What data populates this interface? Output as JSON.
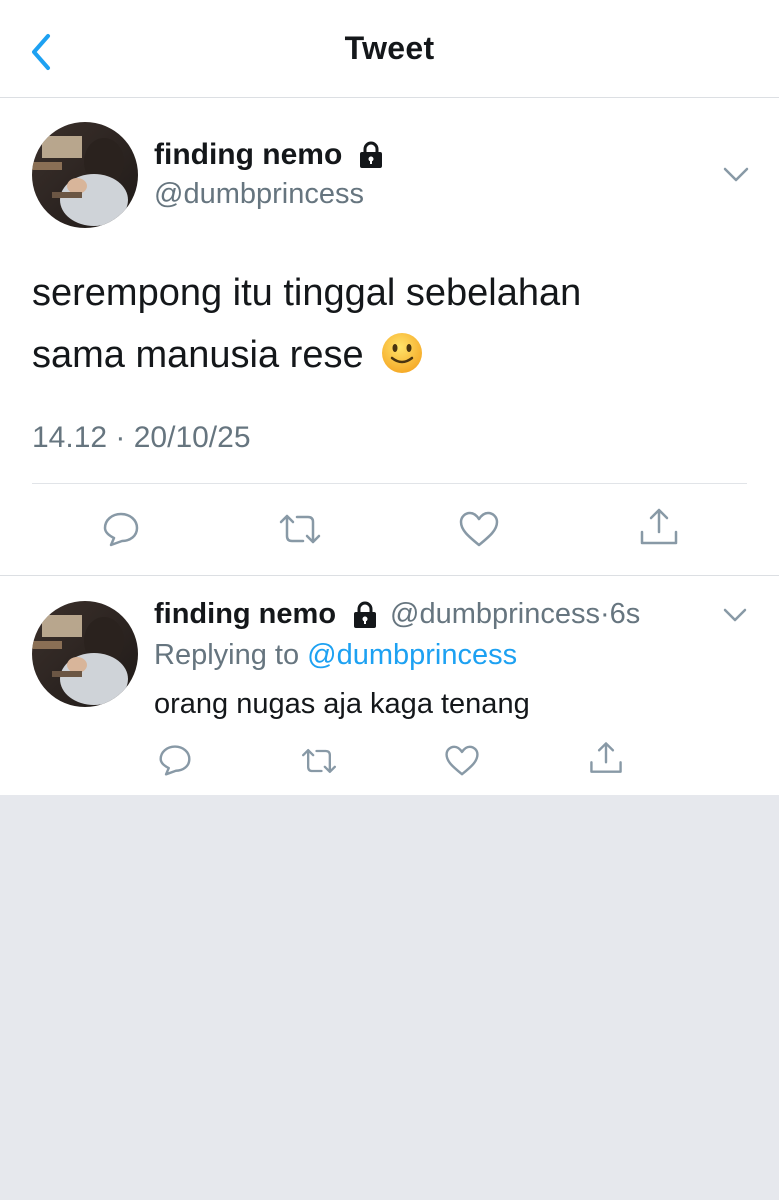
{
  "header": {
    "title": "Tweet"
  },
  "main_tweet": {
    "author_name": "finding nemo",
    "handle": "@dumbprincess",
    "text_line1": "serempong itu tinggal sebelahan",
    "text_line2": "sama manusia rese",
    "emoji": "slightly-smiling-face",
    "timestamp": "14.12 · 20/10/25"
  },
  "reply": {
    "author_name": "finding nemo",
    "handle": "@dumbprincess",
    "time": "·6s",
    "replying_prefix": "Replying to",
    "replying_handle": "@dumbprincess",
    "text": "orang nugas aja kaga tenang"
  },
  "icons": [
    "back-chevron-icon",
    "lock-icon",
    "chevron-down-icon",
    "reply-icon",
    "retweet-icon",
    "like-icon",
    "share-icon"
  ],
  "colors": {
    "accent": "#1da1f2",
    "secondary_text": "#66757f",
    "primary_text": "#14171a",
    "background": "#e6e8ed"
  }
}
